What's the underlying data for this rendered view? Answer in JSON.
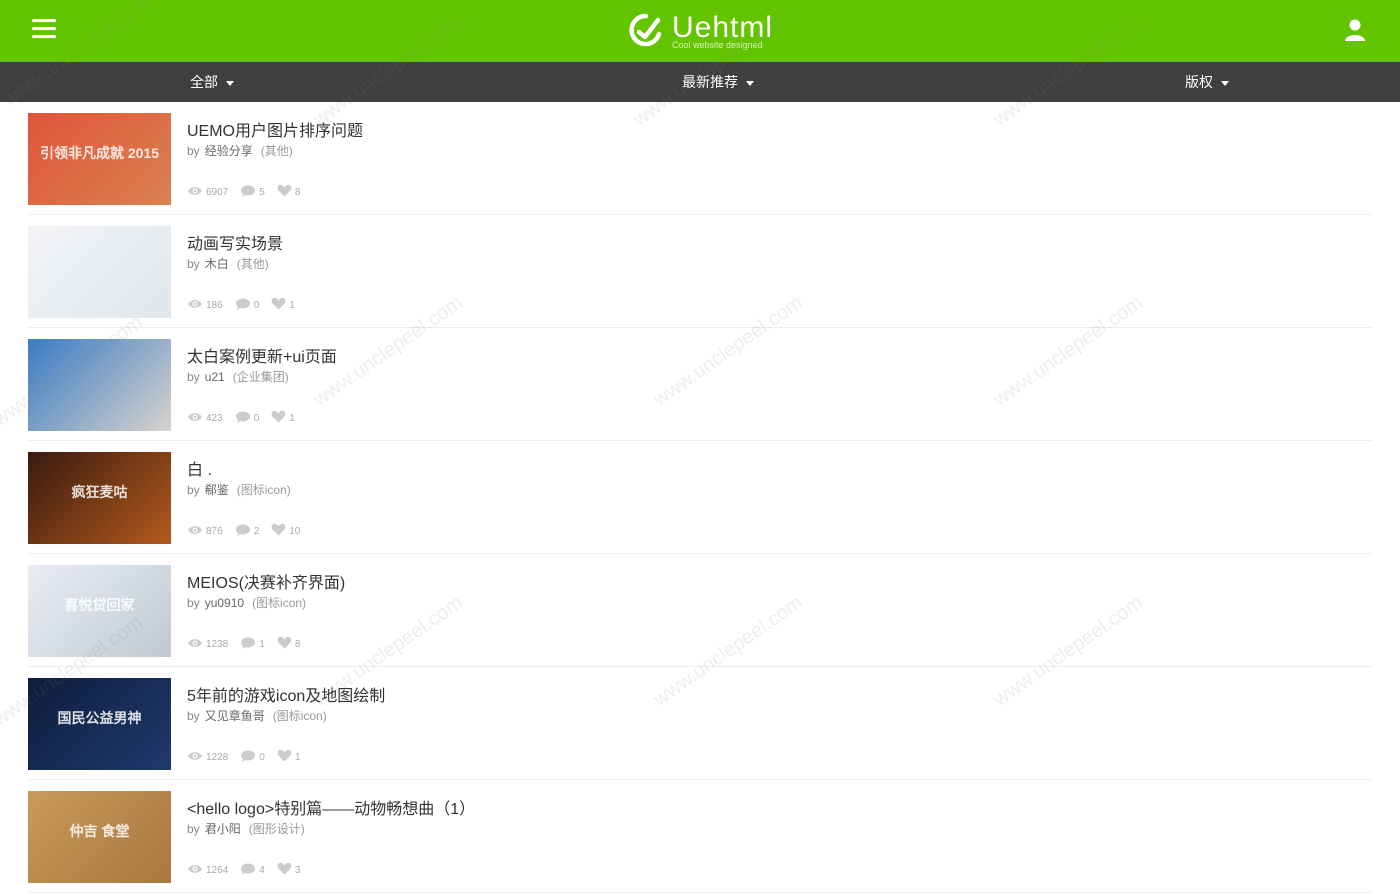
{
  "header": {
    "logo_text": "Uehtml",
    "logo_sub": "Cool website designed",
    "watermark": "www.unclepeel.com",
    "brand_color": "#63c400"
  },
  "filters": [
    {
      "label": "全部"
    },
    {
      "label": "最新推荐"
    },
    {
      "label": "版权"
    }
  ],
  "items": [
    {
      "title": "UEMO用户图片排序问题",
      "by": "by",
      "author": "经验分享",
      "category": "(其他)",
      "views": "6907",
      "comments": "5",
      "likes": "8",
      "thumb_text": "引领非凡成就 2015",
      "thumb_colors": [
        "#e0553a",
        "#d9824f"
      ]
    },
    {
      "title": "动画写实场景",
      "by": "by",
      "author": "木白",
      "category": "(其他)",
      "views": "186",
      "comments": "0",
      "likes": "1",
      "thumb_text": "",
      "thumb_colors": [
        "#f3f4f6",
        "#dfe7ec"
      ]
    },
    {
      "title": "太白案例更新+ui页面",
      "by": "by",
      "author": "u21",
      "category": "(企业集团)",
      "views": "423",
      "comments": "0",
      "likes": "1",
      "thumb_text": "",
      "thumb_colors": [
        "#3a7cc4",
        "#d7d3cd"
      ]
    },
    {
      "title": "白 .",
      "by": "by",
      "author": "郗鉴",
      "category": "(图标icon)",
      "views": "876",
      "comments": "2",
      "likes": "10",
      "thumb_text": "疯狂麦咕",
      "thumb_colors": [
        "#3a1a0f",
        "#b35a1c"
      ]
    },
    {
      "title": "MEIOS(决赛补齐界面)",
      "by": "by",
      "author": "yu0910",
      "category": "(图标icon)",
      "views": "1238",
      "comments": "1",
      "likes": "8",
      "thumb_text": "喜悦贷回家",
      "thumb_colors": [
        "#e9eef3",
        "#bfc9d3"
      ]
    },
    {
      "title": "5年前的游戏icon及地图绘制",
      "by": "by",
      "author": "又见章鱼哥",
      "category": "(图标icon)",
      "views": "1228",
      "comments": "0",
      "likes": "1",
      "thumb_text": "国民公益男神",
      "thumb_colors": [
        "#0e1d3d",
        "#1f3a6e"
      ]
    },
    {
      "title": "<hello logo>特别篇——动物畅想曲（1）",
      "by": "by",
      "author": "君小阳",
      "category": "(图形设计)",
      "views": "1264",
      "comments": "4",
      "likes": "3",
      "thumb_text": "仲吉 食堂",
      "thumb_colors": [
        "#c99a5a",
        "#a9773f"
      ]
    }
  ]
}
